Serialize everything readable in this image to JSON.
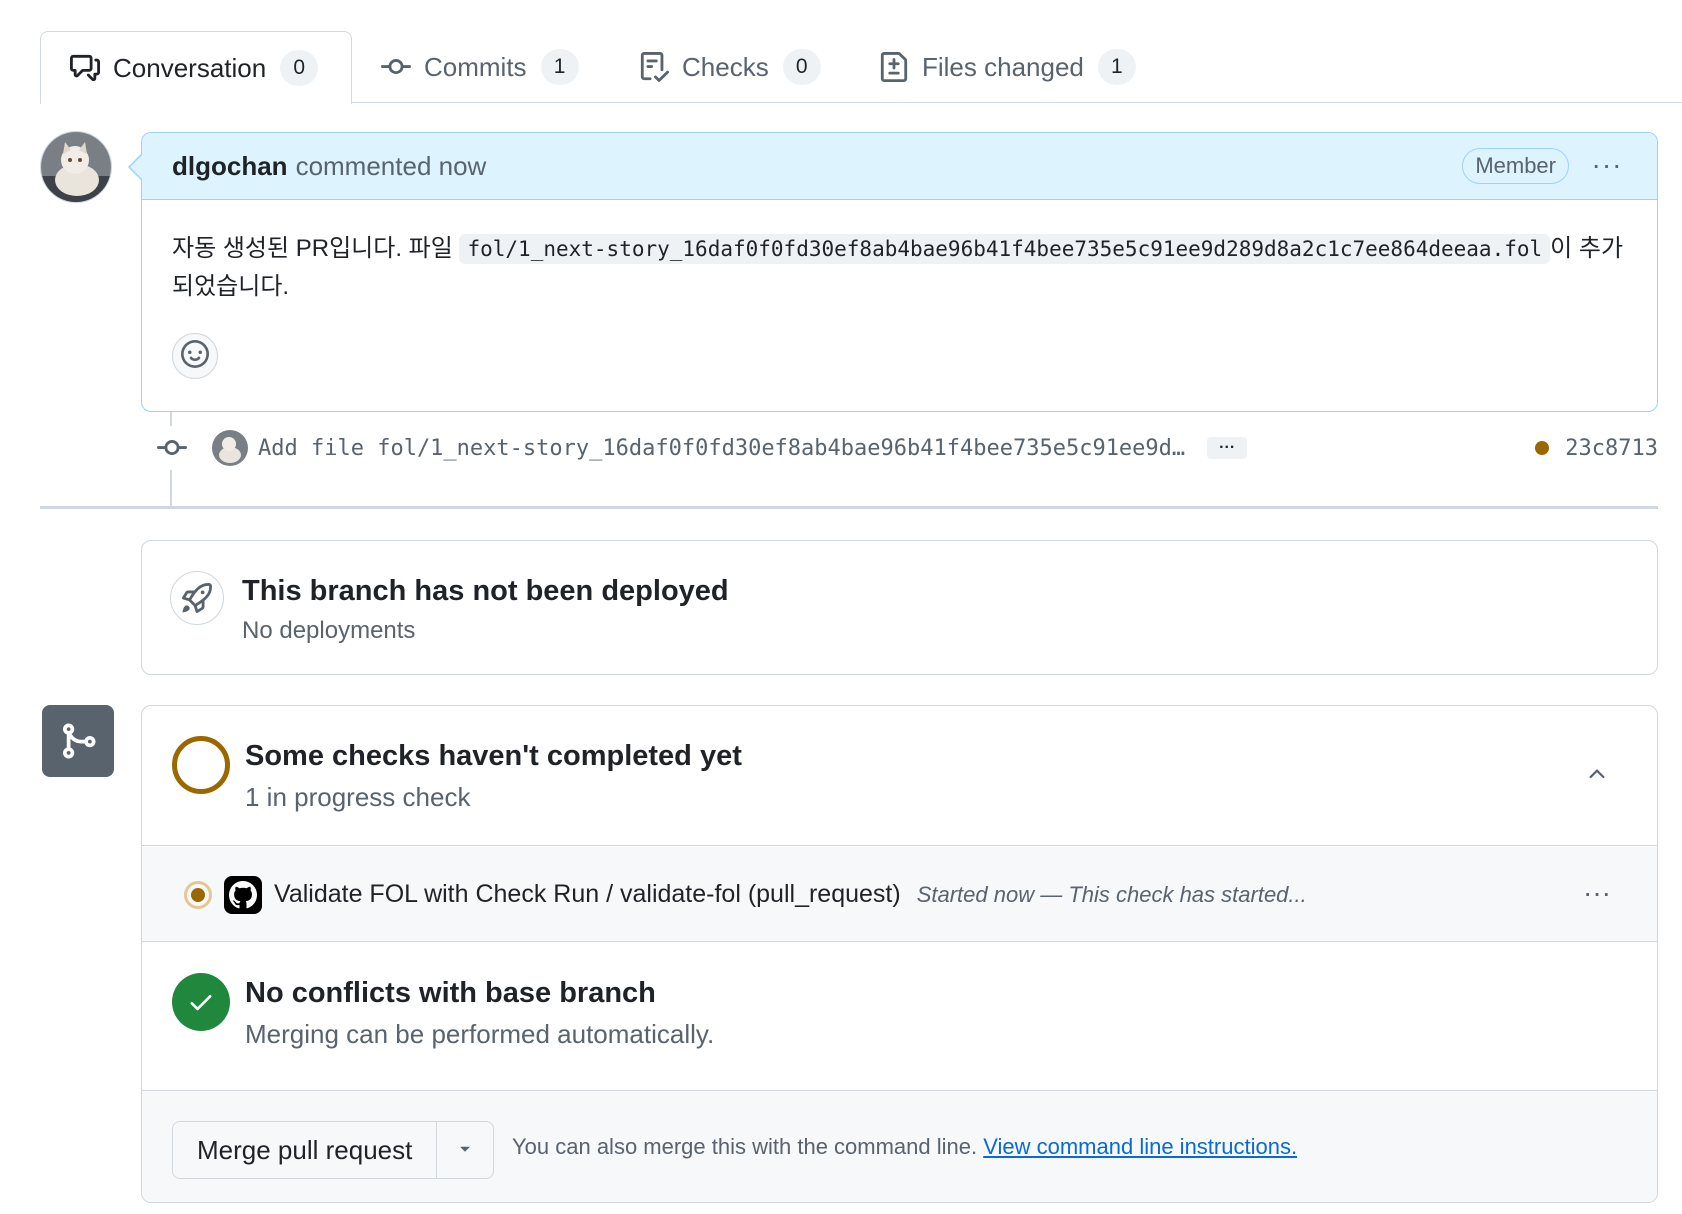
{
  "tabs": [
    {
      "label": "Conversation",
      "count": "0",
      "icon": "comment-discussion-icon"
    },
    {
      "label": "Commits",
      "count": "1",
      "icon": "git-commit-icon"
    },
    {
      "label": "Checks",
      "count": "0",
      "icon": "checklist-icon"
    },
    {
      "label": "Files changed",
      "count": "1",
      "icon": "file-diff-icon"
    }
  ],
  "comment": {
    "author": "dlgochan",
    "meta": "commented now",
    "badge": "Member",
    "menu": "···",
    "body_before": "자동 생성된 PR입니다. 파일 ",
    "file_code": "fol/1_next-story_16daf0f0fd30ef8ab4bae96b41f4bee735e5c91ee9d289d8a2c1c7ee864deeaa.fol",
    "body_after": "이 추가되었습니다.",
    "reaction_icon": "smiley-icon"
  },
  "commit": {
    "message": "Add file fol/1_next-story_16daf0f0fd30ef8ab4bae96b41f4bee735e5c91ee9d…",
    "ellipsis": "···",
    "sha": "23c8713",
    "status_color": "#9a6700"
  },
  "deployment": {
    "title": "This branch has not been deployed",
    "subtitle": "No deployments",
    "icon": "rocket-icon"
  },
  "checks": {
    "title": "Some checks haven't completed yet",
    "subtitle": "1 in progress check",
    "item": {
      "name": "Validate FOL with Check Run / validate-fol (pull_request)",
      "description": "Started now — This check has started...",
      "menu": "···"
    }
  },
  "conflicts": {
    "title": "No conflicts with base branch",
    "subtitle": "Merging can be performed automatically."
  },
  "merge": {
    "button": "Merge pull request",
    "cli_text": "You can also merge this with the command line. ",
    "cli_link": "View command line instructions."
  },
  "colors": {
    "pending": "#9a6700",
    "success": "#1f883d",
    "link": "#0969da",
    "comment_header": "#ddf4ff"
  }
}
